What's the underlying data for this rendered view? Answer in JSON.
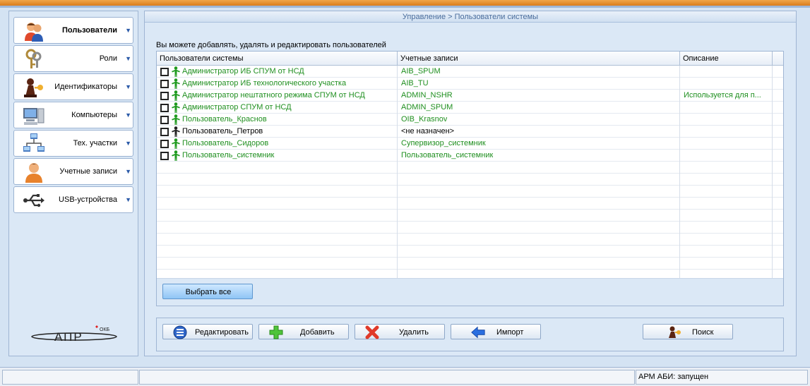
{
  "sidebar": {
    "items": [
      {
        "label": "Пользователи",
        "active": true,
        "icon": "users-icon"
      },
      {
        "label": "Роли",
        "icon": "keys-icon"
      },
      {
        "label": "Идентификаторы",
        "icon": "key-token-icon"
      },
      {
        "label": "Компьютеры",
        "icon": "computer-icon"
      },
      {
        "label": "Тех. участки",
        "icon": "network-icon"
      },
      {
        "label": "Учетные записи",
        "icon": "account-icon"
      },
      {
        "label": "USB-устройства",
        "icon": "usb-icon"
      }
    ],
    "logo_text": "АПР",
    "logo_sub": "ОКБ"
  },
  "main": {
    "breadcrumb": "Управление > Пользователи системы",
    "info": "Вы можете добавлять, удалять и редактировать пользователей",
    "table": {
      "columns": [
        "Пользователи системы",
        "Учетные записи",
        "Описание"
      ],
      "rows": [
        {
          "user": "Администратор ИБ СПУМ от НСД",
          "account": "AIB_SPUM",
          "description": "",
          "active": true
        },
        {
          "user": "Администратор ИБ технологического участка",
          "account": "AIB_TU",
          "description": "",
          "active": true
        },
        {
          "user": "Администратор нештатного режима СПУМ от НСД",
          "account": "ADMIN_NSHR",
          "description": "Используется для п...",
          "active": true
        },
        {
          "user": "Администратор СПУМ от НСД",
          "account": "ADMIN_SPUM",
          "description": "",
          "active": true
        },
        {
          "user": "Пользователь_Краснов",
          "account": "OIB_Krasnov",
          "description": "",
          "active": true
        },
        {
          "user": "Пользователь_Петров",
          "account": "<не назначен>",
          "description": "",
          "active": false
        },
        {
          "user": "Пользователь_Сидоров",
          "account": "Супервизор_системник",
          "description": "",
          "active": true
        },
        {
          "user": "Пользователь_системник",
          "account": "Пользователь_системник",
          "description": "",
          "active": true
        }
      ]
    },
    "select_all": "Выбрать все",
    "actions": {
      "edit": "Редактировать",
      "add": "Добавить",
      "delete": "Удалить",
      "import": "Импорт",
      "search": "Поиск"
    }
  },
  "status": {
    "right": "АРМ АБИ: запущен"
  },
  "colors": {
    "active_user": "#1f8f1f",
    "accent_top": "#e8922f",
    "panel_bg": "#dbe8f6"
  }
}
